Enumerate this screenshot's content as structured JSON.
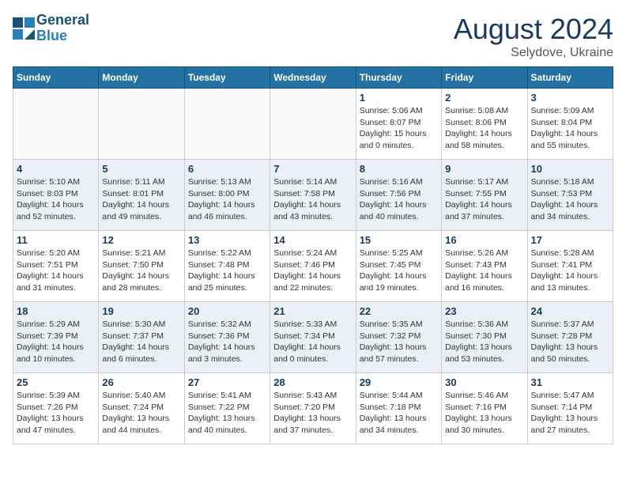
{
  "header": {
    "logo_line1": "General",
    "logo_line2": "Blue",
    "month_year": "August 2024",
    "location": "Selydove, Ukraine"
  },
  "weekdays": [
    "Sunday",
    "Monday",
    "Tuesday",
    "Wednesday",
    "Thursday",
    "Friday",
    "Saturday"
  ],
  "weeks": [
    [
      {
        "day": "",
        "info": ""
      },
      {
        "day": "",
        "info": ""
      },
      {
        "day": "",
        "info": ""
      },
      {
        "day": "",
        "info": ""
      },
      {
        "day": "1",
        "info": "Sunrise: 5:06 AM\nSunset: 8:07 PM\nDaylight: 15 hours\nand 0 minutes."
      },
      {
        "day": "2",
        "info": "Sunrise: 5:08 AM\nSunset: 8:06 PM\nDaylight: 14 hours\nand 58 minutes."
      },
      {
        "day": "3",
        "info": "Sunrise: 5:09 AM\nSunset: 8:04 PM\nDaylight: 14 hours\nand 55 minutes."
      }
    ],
    [
      {
        "day": "4",
        "info": "Sunrise: 5:10 AM\nSunset: 8:03 PM\nDaylight: 14 hours\nand 52 minutes."
      },
      {
        "day": "5",
        "info": "Sunrise: 5:11 AM\nSunset: 8:01 PM\nDaylight: 14 hours\nand 49 minutes."
      },
      {
        "day": "6",
        "info": "Sunrise: 5:13 AM\nSunset: 8:00 PM\nDaylight: 14 hours\nand 46 minutes."
      },
      {
        "day": "7",
        "info": "Sunrise: 5:14 AM\nSunset: 7:58 PM\nDaylight: 14 hours\nand 43 minutes."
      },
      {
        "day": "8",
        "info": "Sunrise: 5:16 AM\nSunset: 7:56 PM\nDaylight: 14 hours\nand 40 minutes."
      },
      {
        "day": "9",
        "info": "Sunrise: 5:17 AM\nSunset: 7:55 PM\nDaylight: 14 hours\nand 37 minutes."
      },
      {
        "day": "10",
        "info": "Sunrise: 5:18 AM\nSunset: 7:53 PM\nDaylight: 14 hours\nand 34 minutes."
      }
    ],
    [
      {
        "day": "11",
        "info": "Sunrise: 5:20 AM\nSunset: 7:51 PM\nDaylight: 14 hours\nand 31 minutes."
      },
      {
        "day": "12",
        "info": "Sunrise: 5:21 AM\nSunset: 7:50 PM\nDaylight: 14 hours\nand 28 minutes."
      },
      {
        "day": "13",
        "info": "Sunrise: 5:22 AM\nSunset: 7:48 PM\nDaylight: 14 hours\nand 25 minutes."
      },
      {
        "day": "14",
        "info": "Sunrise: 5:24 AM\nSunset: 7:46 PM\nDaylight: 14 hours\nand 22 minutes."
      },
      {
        "day": "15",
        "info": "Sunrise: 5:25 AM\nSunset: 7:45 PM\nDaylight: 14 hours\nand 19 minutes."
      },
      {
        "day": "16",
        "info": "Sunrise: 5:26 AM\nSunset: 7:43 PM\nDaylight: 14 hours\nand 16 minutes."
      },
      {
        "day": "17",
        "info": "Sunrise: 5:28 AM\nSunset: 7:41 PM\nDaylight: 14 hours\nand 13 minutes."
      }
    ],
    [
      {
        "day": "18",
        "info": "Sunrise: 5:29 AM\nSunset: 7:39 PM\nDaylight: 14 hours\nand 10 minutes."
      },
      {
        "day": "19",
        "info": "Sunrise: 5:30 AM\nSunset: 7:37 PM\nDaylight: 14 hours\nand 6 minutes."
      },
      {
        "day": "20",
        "info": "Sunrise: 5:32 AM\nSunset: 7:36 PM\nDaylight: 14 hours\nand 3 minutes."
      },
      {
        "day": "21",
        "info": "Sunrise: 5:33 AM\nSunset: 7:34 PM\nDaylight: 14 hours\nand 0 minutes."
      },
      {
        "day": "22",
        "info": "Sunrise: 5:35 AM\nSunset: 7:32 PM\nDaylight: 13 hours\nand 57 minutes."
      },
      {
        "day": "23",
        "info": "Sunrise: 5:36 AM\nSunset: 7:30 PM\nDaylight: 13 hours\nand 53 minutes."
      },
      {
        "day": "24",
        "info": "Sunrise: 5:37 AM\nSunset: 7:28 PM\nDaylight: 13 hours\nand 50 minutes."
      }
    ],
    [
      {
        "day": "25",
        "info": "Sunrise: 5:39 AM\nSunset: 7:26 PM\nDaylight: 13 hours\nand 47 minutes."
      },
      {
        "day": "26",
        "info": "Sunrise: 5:40 AM\nSunset: 7:24 PM\nDaylight: 13 hours\nand 44 minutes."
      },
      {
        "day": "27",
        "info": "Sunrise: 5:41 AM\nSunset: 7:22 PM\nDaylight: 13 hours\nand 40 minutes."
      },
      {
        "day": "28",
        "info": "Sunrise: 5:43 AM\nSunset: 7:20 PM\nDaylight: 13 hours\nand 37 minutes."
      },
      {
        "day": "29",
        "info": "Sunrise: 5:44 AM\nSunset: 7:18 PM\nDaylight: 13 hours\nand 34 minutes."
      },
      {
        "day": "30",
        "info": "Sunrise: 5:46 AM\nSunset: 7:16 PM\nDaylight: 13 hours\nand 30 minutes."
      },
      {
        "day": "31",
        "info": "Sunrise: 5:47 AM\nSunset: 7:14 PM\nDaylight: 13 hours\nand 27 minutes."
      }
    ]
  ]
}
